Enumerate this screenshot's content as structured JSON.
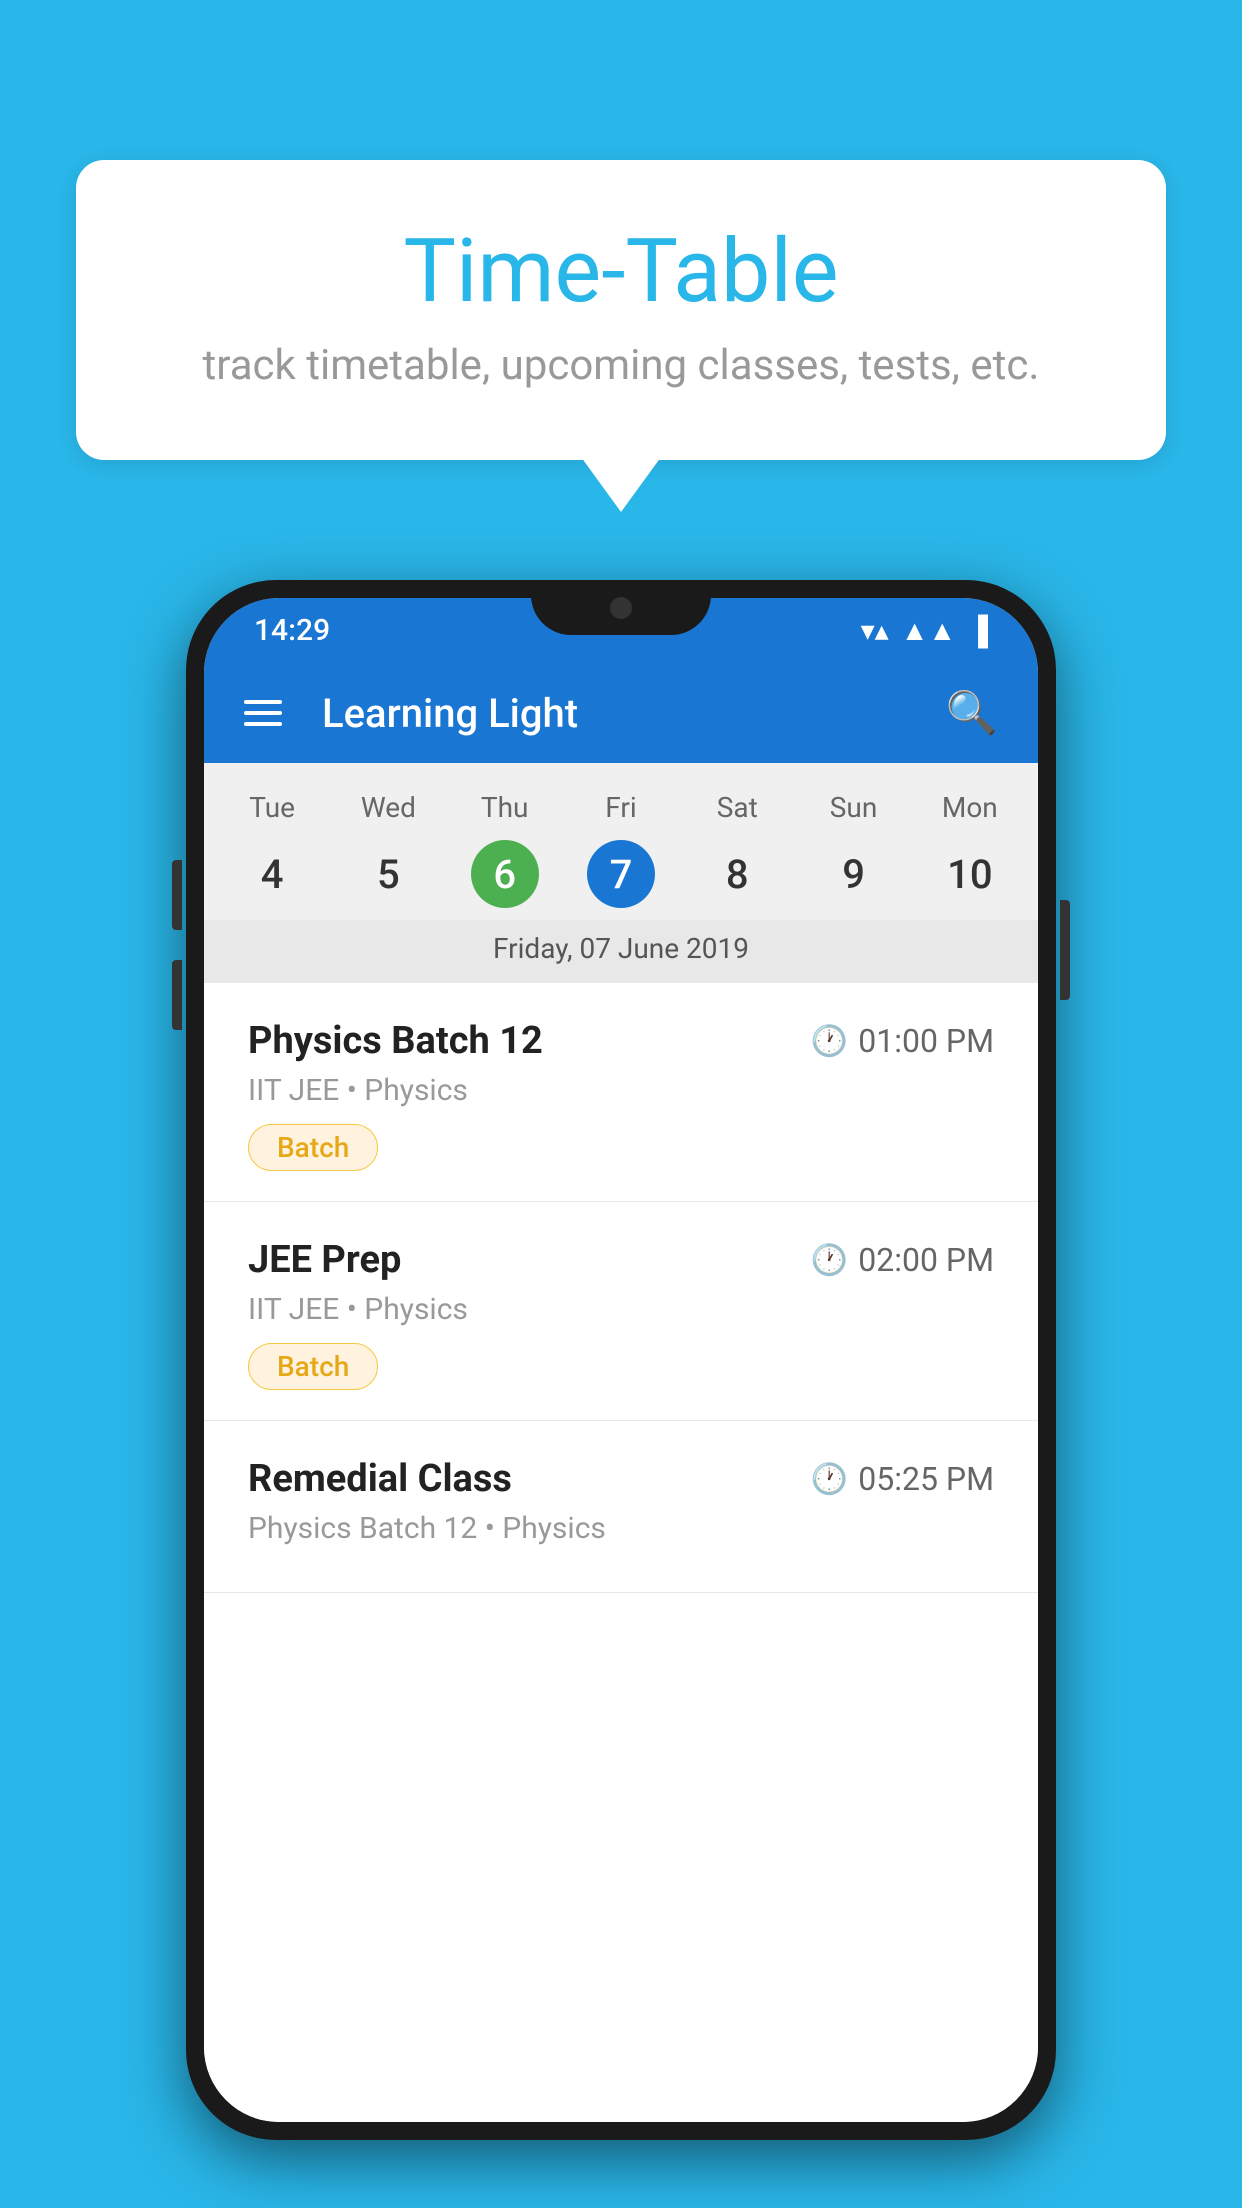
{
  "background_color": "#29B6E8",
  "bubble": {
    "title": "Time-Table",
    "subtitle": "track timetable, upcoming classes, tests, etc."
  },
  "phone": {
    "status_bar": {
      "time": "14:29",
      "icons": [
        "wifi",
        "signal",
        "battery"
      ]
    },
    "app_bar": {
      "title": "Learning Light",
      "search_label": "search"
    },
    "calendar": {
      "days": [
        "Tue",
        "Wed",
        "Thu",
        "Fri",
        "Sat",
        "Sun",
        "Mon"
      ],
      "dates": [
        "4",
        "5",
        "6",
        "7",
        "8",
        "9",
        "10"
      ],
      "today_index": 2,
      "selected_index": 3,
      "selected_date_label": "Friday, 07 June 2019"
    },
    "schedule": [
      {
        "title": "Physics Batch 12",
        "time": "01:00 PM",
        "sub": "IIT JEE • Physics",
        "tag": "Batch"
      },
      {
        "title": "JEE Prep",
        "time": "02:00 PM",
        "sub": "IIT JEE • Physics",
        "tag": "Batch"
      },
      {
        "title": "Remedial Class",
        "time": "05:25 PM",
        "sub": "Physics Batch 12 • Physics",
        "tag": ""
      }
    ]
  }
}
